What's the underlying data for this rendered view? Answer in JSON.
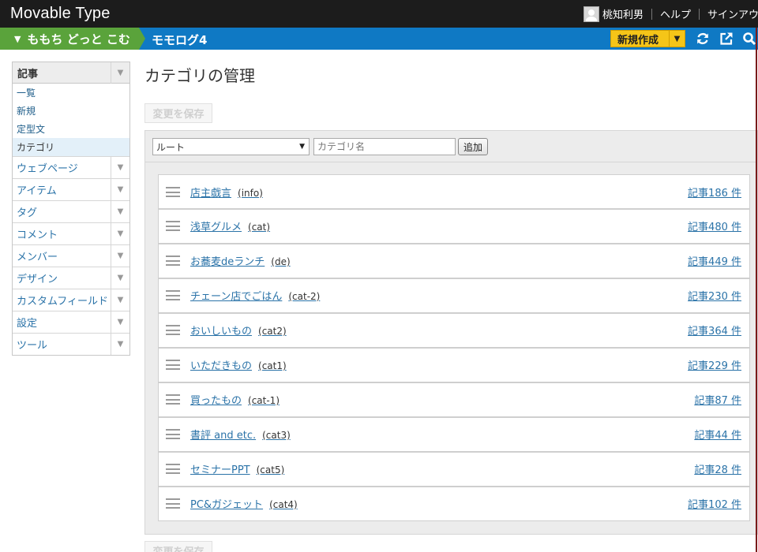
{
  "header": {
    "brand": "Movable Type",
    "user_name": "桃知利男",
    "help": "ヘルプ",
    "signout": "サインアウト"
  },
  "sitebar": {
    "site_name": "ももち どっと こむ",
    "blog_name": "モモログ4",
    "new_button": "新規作成",
    "icons": [
      "refresh-icon",
      "external-view-icon",
      "search-icon"
    ]
  },
  "sidebar": {
    "section": "記事",
    "sub_items": [
      {
        "label": "一覧"
      },
      {
        "label": "新規"
      },
      {
        "label": "定型文"
      },
      {
        "label": "カテゴリ"
      }
    ],
    "items": [
      {
        "label": "ウェブページ"
      },
      {
        "label": "アイテム"
      },
      {
        "label": "タグ"
      },
      {
        "label": "コメント"
      },
      {
        "label": "メンバー"
      },
      {
        "label": "デザイン"
      },
      {
        "label": "カスタムフィールド"
      },
      {
        "label": "設定"
      },
      {
        "label": "ツール"
      }
    ]
  },
  "main": {
    "title": "カテゴリの管理",
    "save_label": "変更を保存",
    "parent_select": "ルート",
    "name_placeholder": "カテゴリ名",
    "add_label": "追加"
  },
  "categories": [
    {
      "name": "店主戯言",
      "slug": "(info)",
      "count": "記事186 件"
    },
    {
      "name": "浅草グルメ",
      "slug": "(cat)",
      "count": "記事480 件"
    },
    {
      "name": "お蕎麦deランチ",
      "slug": "(de)",
      "count": "記事449 件"
    },
    {
      "name": "チェーン店でごはん",
      "slug": "(cat-2)",
      "count": "記事230 件"
    },
    {
      "name": "おいしいもの",
      "slug": "(cat2)",
      "count": "記事364 件"
    },
    {
      "name": "いただきもの",
      "slug": "(cat1)",
      "count": "記事229 件"
    },
    {
      "name": "買ったもの",
      "slug": "(cat-1)",
      "count": "記事87 件"
    },
    {
      "name": "書評 and etc.",
      "slug": "(cat3)",
      "count": "記事44 件"
    },
    {
      "name": "セミナーPPT",
      "slug": "(cat5)",
      "count": "記事28 件"
    },
    {
      "name": "PC&ガジェット",
      "slug": "(cat4)",
      "count": "記事102 件"
    }
  ],
  "colors": {
    "topbar": "#1c1c1c",
    "site_green": "#5aa33b",
    "blog_blue": "#0f79c4",
    "new_button": "#f5c518",
    "link": "#2b73a8"
  }
}
